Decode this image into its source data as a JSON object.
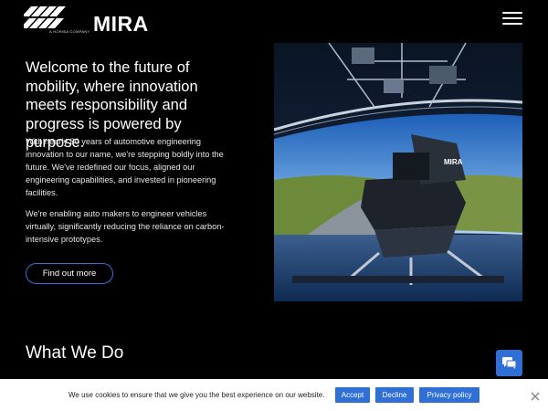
{
  "header": {
    "logo_tagline": "A HORIBA COMPANY",
    "logo_word": "MIRA",
    "menu_icon": "hamburger-menu-icon"
  },
  "hero": {
    "heading": "Welcome to the future of mobility, where innovation meets responsibility and progress is powered by purpose.",
    "paragraph_1": "With nearly 80 years of automotive engineering innovation to our name, we're stepping boldly into the future. We've redefined our focus, aligned our engineering capabilities, and invested in pioneering facilities.",
    "paragraph_2": "We're enabling auto makers to engineer vehicles virtually, significantly reducing the reliance on carbon-intensive prototypes.",
    "cta_label": "Find out more",
    "image_sim_label": "MIRA"
  },
  "section": {
    "title": "What We Do"
  },
  "chat_widget": {
    "icon": "chat-icon"
  },
  "cookie_bar": {
    "message": "We use cookies to ensure that we give you the best experience on our website.",
    "accept_label": "Accept",
    "decline_label": "Decline",
    "policy_label": "Privacy policy",
    "close_icon": "close-icon"
  },
  "colors": {
    "background": "#000000",
    "accent_blue": "#2f6fd6",
    "cta_border": "#3a6fd8",
    "cookie_bar_bg": "#ffffff"
  }
}
